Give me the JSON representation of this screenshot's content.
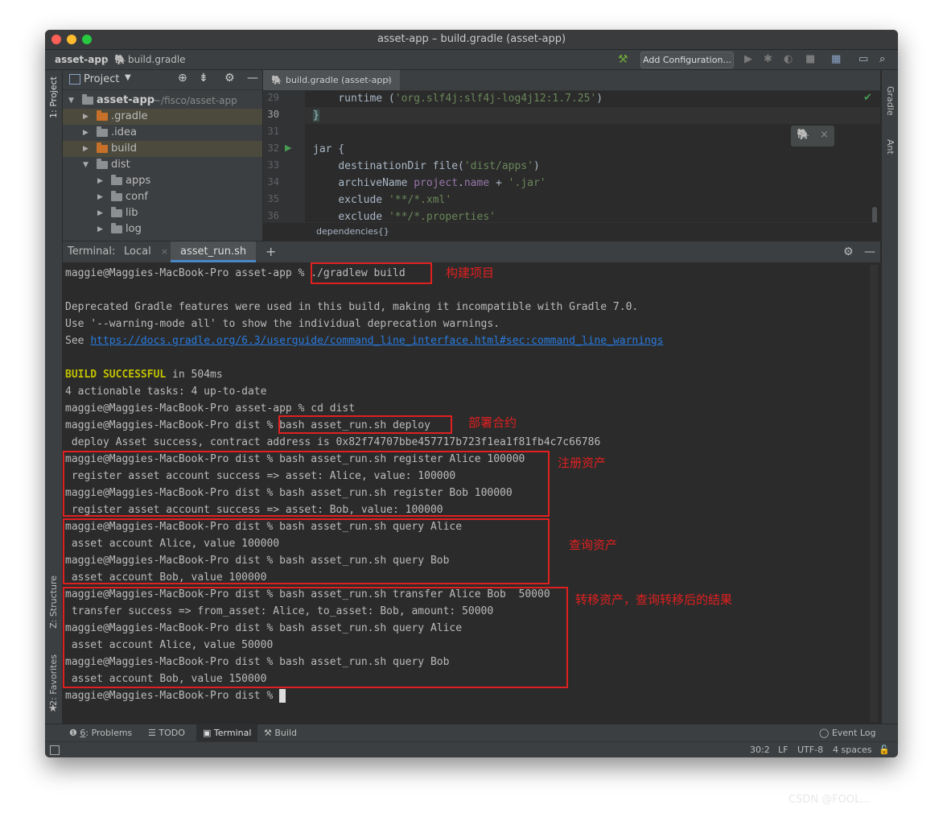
{
  "window": {
    "title": "asset-app – build.gradle (asset-app)"
  },
  "navbar": {
    "project": "asset-app",
    "file": "build.gradle",
    "add_config": "Add Configuration..."
  },
  "left_strip": {
    "project_label": "1: Project",
    "structure_label": "Z: Structure",
    "favorites_label": "2: Favorites"
  },
  "right_strip": {
    "gradle_label": "Gradle",
    "ant_label": "Ant"
  },
  "project_panel": {
    "header": "Project",
    "root_name": "asset-app",
    "root_path": "~/fisco/asset-app",
    "items": [
      ".gradle",
      ".idea",
      "build",
      "dist",
      "apps",
      "conf",
      "lib",
      "log"
    ]
  },
  "editor": {
    "tab": "build.gradle (asset-app)",
    "line_numbers": [
      "29",
      "30",
      "31",
      "32",
      "33",
      "34",
      "35",
      "36"
    ],
    "lines": {
      "l29a": "runtime (",
      "l29b": "'org.slf4j:slf4j-log4j12:1.7.25'",
      "l29c": ")",
      "l30": "}",
      "l32a": "jar",
      "l32b": " {",
      "l33a": "destinationDir file(",
      "l33b": "'dist/apps'",
      "l33c": ")",
      "l34a": "archiveName ",
      "l34b": "project",
      "l34c": ".",
      "l34d": "name",
      "l34e": " + ",
      "l34f": "'.jar'",
      "l35a": "exclude ",
      "l35b": "'**/*.xml'",
      "l36a": "exclude ",
      "l36b": "'**/*.properties'"
    },
    "breadcrumb": "dependencies{}"
  },
  "terminal": {
    "label": "Terminal:",
    "tabs": [
      "Local",
      "asset_run.sh"
    ],
    "add": "+",
    "prompt_app": "maggie@Maggies-MacBook-Pro asset-app % ",
    "prompt_dist": "maggie@Maggies-MacBook-Pro dist % ",
    "cmd_build": "./gradlew build",
    "warn1": "Deprecated Gradle features were used in this build, making it incompatible with Gradle 7.0.",
    "warn2": "Use '--warning-mode all' to show the individual deprecation warnings.",
    "warn3_prefix": "See ",
    "warn3_link": "https://docs.gradle.org/6.3/userguide/command_line_interface.html#sec:command_line_warnings",
    "build_ok": "BUILD SUCCESSFUL",
    "build_time": " in 504ms",
    "tasks": "4 actionable tasks: 4 up-to-date",
    "cmd_cd": "cd dist",
    "cmd_deploy": "bash asset_run.sh deploy",
    "out_deploy": " deploy Asset success, contract address is 0x82f74707bbe457717b723f1ea1f81fb4c7c66786",
    "cmd_reg_alice": "bash asset_run.sh register Alice 100000",
    "out_reg_alice": " register asset account success => asset: Alice, value: 100000",
    "cmd_reg_bob": "bash asset_run.sh register Bob 100000",
    "out_reg_bob": " register asset account success => asset: Bob, value: 100000",
    "cmd_q_alice": "bash asset_run.sh query Alice",
    "out_q_alice1": " asset account Alice, value 100000",
    "cmd_q_bob": "bash asset_run.sh query Bob",
    "out_q_bob1": " asset account Bob, value 100000",
    "cmd_transfer": "bash asset_run.sh transfer Alice Bob  50000",
    "out_transfer": " transfer success => from_asset: Alice, to_asset: Bob, amount: 50000",
    "out_q_alice2": " asset account Alice, value 50000",
    "out_q_bob2": " asset account Bob, value 150000"
  },
  "annotations": {
    "build": "构建项目",
    "deploy": "部署合约",
    "register": "注册资产",
    "query": "查询资产",
    "transfer": "转移资产，查询转移后的结果"
  },
  "toolwindows": {
    "problems_num": "6",
    "problems": ": Problems",
    "todo": "TODO",
    "terminal": "Terminal",
    "build": "Build",
    "event_log": "Event Log"
  },
  "status": {
    "position": "30:2",
    "line_sep": "LF",
    "encoding": "UTF-8",
    "indent": "4 spaces"
  },
  "colors": {
    "annotation_red": "#e02020",
    "link_blue": "#287bde",
    "build_success": "#c0c000"
  },
  "watermark": "CSDN @FOOL..."
}
